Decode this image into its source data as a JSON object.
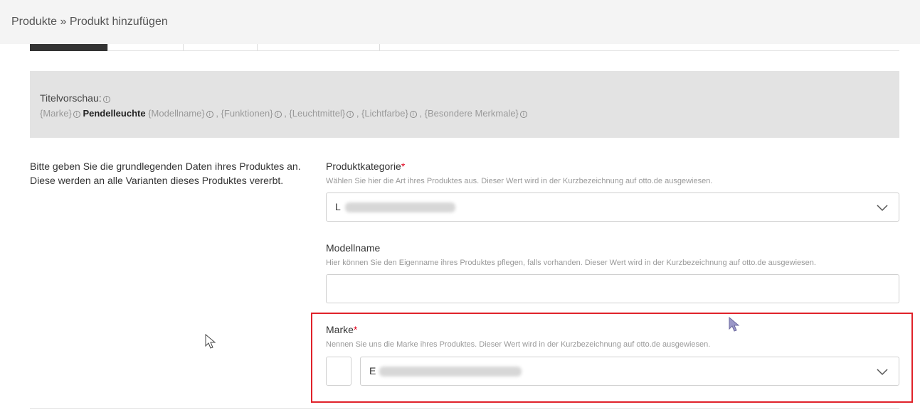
{
  "breadcrumb": {
    "parent": "Produkte",
    "separator": "»",
    "current": "Produkt hinzufügen"
  },
  "preview": {
    "title": "Titelvorschau:",
    "parts": {
      "marke": "{Marke}",
      "category": "Pendelleuchte",
      "modellname": "{Modellname}",
      "funktionen": ", {Funktionen}",
      "leuchtmittel": ", {Leuchtmittel}",
      "lichtfarbe": ", {Lichtfarbe}",
      "besondere": ", {Besondere Merkmale}"
    }
  },
  "intro_text": "Bitte geben Sie die grundlegenden Daten ihres Produktes an. Diese werden an alle Varianten dieses Produktes vererbt.",
  "fields": {
    "produktkategorie": {
      "label": "Produktkategorie",
      "required_mark": "*",
      "help": "Wählen Sie hier die Art ihres Produktes aus. Dieser Wert wird in der Kurzbezeichnung auf otto.de ausgewiesen.",
      "value_initial": "L"
    },
    "modellname": {
      "label": "Modellname",
      "help": "Hier können Sie den Eigenname ihres Produktes pflegen, falls vorhanden. Dieser Wert wird in der Kurzbezeichnung auf otto.de ausgewiesen.",
      "value": ""
    },
    "marke": {
      "label": "Marke",
      "required_mark": "*",
      "help": "Nennen Sie uns die Marke ihres Produktes. Dieser Wert wird in der Kurzbezeichnung auf otto.de ausgewiesen.",
      "value_initial": "E"
    }
  },
  "colors": {
    "highlight": "#e0222a",
    "required": "#e0001b",
    "preview_bg": "#e3e3e3"
  },
  "icons": [
    "info-icon",
    "chevron-down-icon",
    "mouse-cursor-icon"
  ]
}
